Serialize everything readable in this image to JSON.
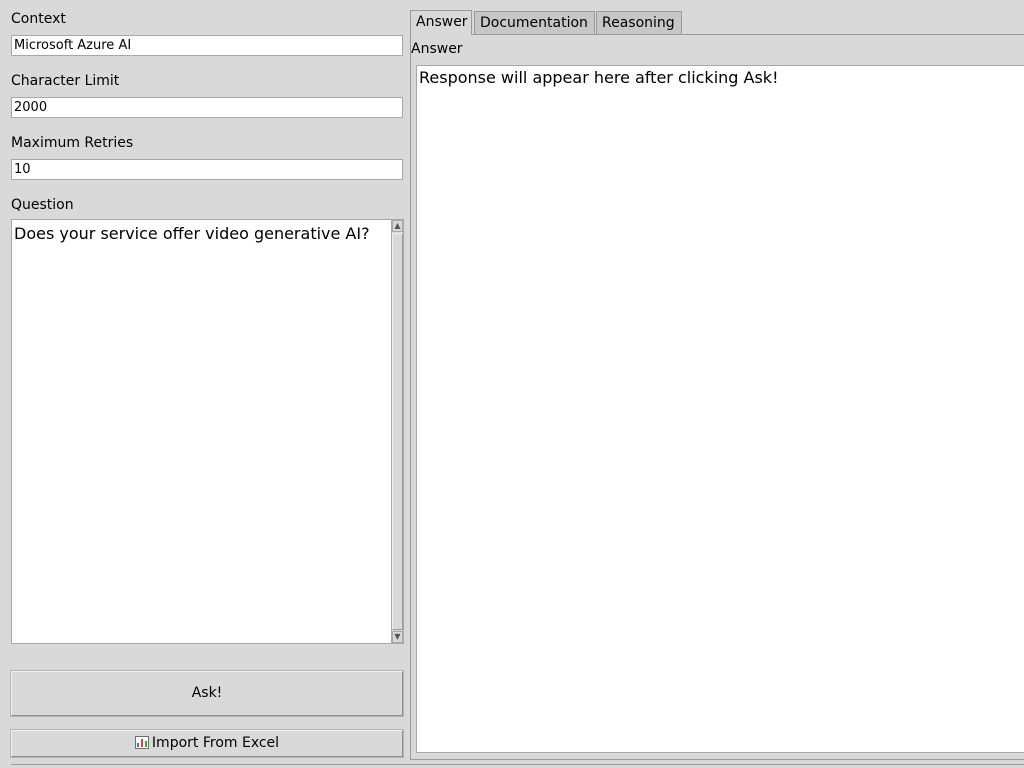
{
  "form": {
    "context_label": "Context",
    "context_value": "Microsoft Azure AI",
    "char_limit_label": "Character Limit",
    "char_limit_value": "2000",
    "retries_label": "Maximum Retries",
    "retries_value": "10",
    "question_label": "Question",
    "question_value": "Does your service offer video generative AI?"
  },
  "buttons": {
    "ask_label": "Ask!",
    "import_label": "Import From Excel",
    "import_icon": "bar-chart-icon"
  },
  "tabs": [
    {
      "label": "Answer",
      "active": true
    },
    {
      "label": "Documentation",
      "active": false
    },
    {
      "label": "Reasoning",
      "active": false
    }
  ],
  "answer": {
    "label": "Answer",
    "text": "Response will appear here after clicking Ask!"
  }
}
